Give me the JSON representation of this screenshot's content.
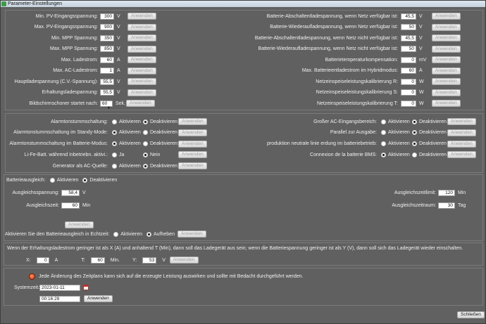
{
  "window": {
    "title": "Parameter-Einstellungen"
  },
  "top_left": [
    {
      "label": "Min. PV-Eingangsspannung:",
      "value": "300",
      "unit": "V",
      "button": "Anwenden"
    },
    {
      "label": "Max. PV-Eingangsspannung:",
      "value": "900",
      "unit": "V",
      "button": "Anwenden"
    },
    {
      "label": "Min. MPP Spannung:",
      "value": "350",
      "unit": "V",
      "button": "Anwenden"
    },
    {
      "label": "Max. MPP Spannung:",
      "value": "850",
      "unit": "V",
      "button": "Anwenden"
    },
    {
      "label": "Max. Ladestrom:",
      "value": "60",
      "unit": "A",
      "button": "Anwenden"
    },
    {
      "label": "Max. AC-Ladestrom:",
      "value": "1",
      "unit": "A",
      "button": "Anwenden"
    },
    {
      "label": "Hauptladespannung (C.V.-Spannung):",
      "value": "55,5",
      "unit": "V",
      "button": "Anwenden"
    },
    {
      "label": "Erhaltungsladespannung:",
      "value": "55,5",
      "unit": "V",
      "button": "Anwenden"
    },
    {
      "label": "Bildschirmschoner startet nach:",
      "value": "60",
      "unit": "Sek.",
      "button": "Anwenden"
    }
  ],
  "top_right": [
    {
      "label": "Batterie-Abschaltentladespannung, wenn Netz verfügbar ist:",
      "value": "45,5",
      "unit": "V",
      "button": "Anwenden"
    },
    {
      "label": "Batterie-Wiederaufladespannung, wenn Netz verfügbar ist:",
      "value": "50",
      "unit": "V",
      "button": "Anwenden"
    },
    {
      "label": "Batterie-Abschaltentladespannung, wenn Netz nicht verfügbar ist:",
      "value": "45,5",
      "unit": "V",
      "button": "Anwenden"
    },
    {
      "label": "Batterie-Wiederaufladespannung, wenn Netz nicht verfügbar ist:",
      "value": "50",
      "unit": "V",
      "button": "Anwenden"
    },
    {
      "label": "Batterietemperaturkompensation:",
      "value": "0",
      "unit": "mV",
      "button": "Anwenden"
    },
    {
      "label": "Max. Batterieentladestrom im Hybridmodus:",
      "value": "60",
      "unit": "A",
      "button": "Anwenden"
    },
    {
      "label": "Netzeinspeiseleistungskalibrierung R:",
      "value": "0",
      "unit": "W",
      "button": "Anwenden"
    },
    {
      "label": "Netzeinspeiseleistungskalibrierung S:",
      "value": "0",
      "unit": "W",
      "button": "Anwenden"
    },
    {
      "label": "Netzeinspeiseleistungskalibrierung T:",
      "value": "0",
      "unit": "W",
      "button": "Anwenden"
    }
  ],
  "mid_left": [
    {
      "label": "Alarmtonstummschaltung:",
      "opt1": "Aktivieren",
      "opt2": "Deaktivieren",
      "selected": 2,
      "button": "Anwenden"
    },
    {
      "label": "Alarmtonstummschaltung im Standy-Mode:",
      "opt1": "Aktivieren",
      "opt2": "Deaktivieren",
      "selected": 1,
      "button": "Anwenden"
    },
    {
      "label": "Alarmtonstummschaltung im Batterie-Modus:",
      "opt1": "Aktivieren",
      "opt2": "Deaktivieren",
      "selected": 1,
      "button": "Anwenden"
    },
    {
      "label": "Li-Fe-Batt. während Inbetriebn. aktivi.:",
      "opt1": "Ja",
      "opt2": "Nein",
      "selected": 2,
      "button": "Anwenden"
    },
    {
      "label": "Generator als AC-Quelle:",
      "opt1": "Aktivieren",
      "opt2": "Deaktivieren",
      "selected": 2,
      "button": "Anwenden"
    }
  ],
  "mid_right": [
    {
      "label": "Großer AC-Eingangsbereich:",
      "opt1": "Aktivieren",
      "opt2": "Deaktivieren",
      "selected": 2,
      "button": "Anwenden"
    },
    {
      "label": "Parallel zur Ausgabe:",
      "opt1": "Aktivieren",
      "opt2": "Deaktivieren",
      "selected": 2,
      "button": "Anwenden"
    },
    {
      "label": "produktion neutrale linie erdung im batteriebetrieb:",
      "opt1": "Aktivieren",
      "opt2": "Deaktivieren",
      "selected": 2,
      "button": "Anwenden"
    },
    {
      "label": "Connexion de la batterie BMS:",
      "opt1": "Aktivieren",
      "opt2": "Deaktivieren",
      "selected": 1,
      "button": "Anwenden"
    }
  ],
  "balance": {
    "label": "Batterieausgleich:",
    "opt1": "Aktivieren",
    "opt2": "Deaktivieren",
    "voltage_label": "Ausgleichsspannung:",
    "voltage_value": "58,4",
    "voltage_unit": "V",
    "time_label": "Ausgleichszeit:",
    "time_value": "60",
    "time_unit": "Min",
    "timeout_label": "Ausgleichszeitlimit:",
    "timeout_value": "120",
    "timeout_unit": "Min",
    "period_label": "Ausgleichszeitraum:",
    "period_value": "30",
    "period_unit": "Tag",
    "apply": "Anwenden",
    "realtime_label": "Aktivieren Sie den Batterieausgleich in Echtzeit:",
    "rt_opt1": "Aktivieren",
    "rt_opt2": "Aufheben",
    "rt_button": "Anwenden"
  },
  "float_rule": {
    "text": "Wenn der Erhaltungsladestrom geringer ist als X (A) und anhaltend T (Min), dann soll das Ladegerät aus sein; wenn die Batteriespannung geringer ist als Y (V), dann soll sich das Ladegerät wieder einschalten.",
    "x_label": "X:",
    "x_value": "0",
    "x_unit": "A",
    "t_label": "T:",
    "t_value": "60",
    "t_unit": "Min.",
    "y_label": "Y:",
    "y_value": "53",
    "y_unit": "V",
    "button": "Anwenden"
  },
  "system": {
    "warning": "Jede Änderung des Zeitplans kann sich auf die erzeugte Leistung auswirken und sollte mit Bedacht durchgeführt werden.",
    "time_label": "Systemzeit:",
    "date": "2023-01-11",
    "time": "00:16:29",
    "button": "Anwenden"
  },
  "close_button": "Schließen"
}
